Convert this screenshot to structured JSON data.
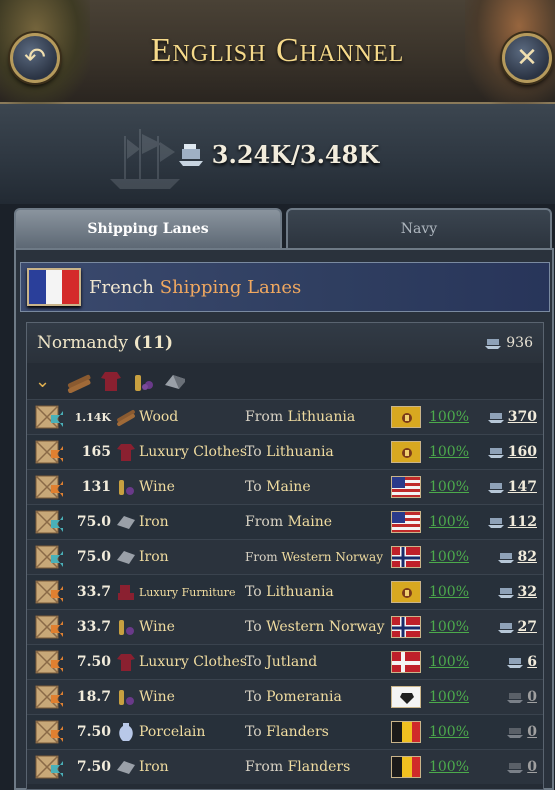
{
  "header": {
    "title": "English Channel",
    "back_icon": "back-arrow-icon",
    "close_icon": "close-icon"
  },
  "capacity": {
    "text": "3.24K/3.48K"
  },
  "tabs": [
    {
      "label": "Shipping Lanes",
      "active": true
    },
    {
      "label": "Navy",
      "active": false
    }
  ],
  "lanes": {
    "country": "French",
    "label": "Shipping Lanes"
  },
  "region": {
    "name": "Normandy",
    "count": "(11)",
    "capacity": "936"
  },
  "rows": [
    {
      "qty": "1.14K",
      "good": "Wood",
      "dir": "From",
      "place": "Lithuania",
      "flag": "lithuania",
      "pct": "100%",
      "cap": "370",
      "arrow": "in"
    },
    {
      "qty": "165",
      "good": "Luxury Clothes",
      "dir": "To",
      "place": "Lithuania",
      "flag": "lithuania",
      "pct": "100%",
      "cap": "160",
      "arrow": "out"
    },
    {
      "qty": "131",
      "good": "Wine",
      "dir": "To",
      "place": "Maine",
      "flag": "usa",
      "pct": "100%",
      "cap": "147",
      "arrow": "out"
    },
    {
      "qty": "75.0",
      "good": "Iron",
      "dir": "From",
      "place": "Maine",
      "flag": "usa",
      "pct": "100%",
      "cap": "112",
      "arrow": "in"
    },
    {
      "qty": "75.0",
      "good": "Iron",
      "dir": "From",
      "place": "Western Norway",
      "flag": "norway",
      "pct": "100%",
      "cap": "82",
      "arrow": "in"
    },
    {
      "qty": "33.7",
      "good": "Luxury Furniture",
      "dir": "To",
      "place": "Lithuania",
      "flag": "lithuania",
      "pct": "100%",
      "cap": "32",
      "arrow": "out"
    },
    {
      "qty": "33.7",
      "good": "Wine",
      "dir": "To",
      "place": "Western Norway",
      "flag": "norway",
      "pct": "100%",
      "cap": "27",
      "arrow": "out"
    },
    {
      "qty": "7.50",
      "good": "Luxury Clothes",
      "dir": "To",
      "place": "Jutland",
      "flag": "denmark",
      "pct": "100%",
      "cap": "6",
      "arrow": "out"
    },
    {
      "qty": "18.7",
      "good": "Wine",
      "dir": "To",
      "place": "Pomerania",
      "flag": "prussia",
      "pct": "100%",
      "cap": "0",
      "arrow": "out"
    },
    {
      "qty": "7.50",
      "good": "Porcelain",
      "dir": "To",
      "place": "Flanders",
      "flag": "belgium",
      "pct": "100%",
      "cap": "0",
      "arrow": "out"
    },
    {
      "qty": "7.50",
      "good": "Iron",
      "dir": "From",
      "place": "Flanders",
      "flag": "belgium",
      "pct": "100%",
      "cap": "0",
      "arrow": "in"
    }
  ],
  "colors": {
    "title_gold": "#f5d98a",
    "percent_green": "#4caa4c",
    "lanes_accent": "#f0a860"
  }
}
